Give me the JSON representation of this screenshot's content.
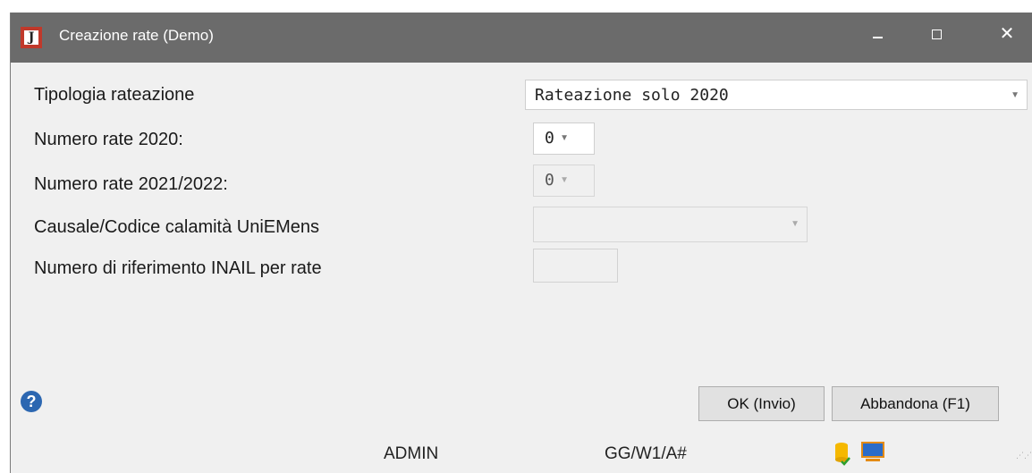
{
  "window": {
    "title": "Creazione rate  (Demo)",
    "app_icon_letter": "J",
    "controls": {
      "minimize": "–",
      "maximize": "□",
      "close": "✕"
    }
  },
  "form": {
    "rows": [
      {
        "label": "Tipologia rateazione",
        "value": "Rateazione solo 2020",
        "type": "dropdown",
        "enabled": true
      },
      {
        "label": "Numero rate 2020:",
        "value": "0",
        "type": "spinner",
        "enabled": true
      },
      {
        "label": "Numero rate 2021/2022:",
        "value": "0",
        "type": "spinner",
        "enabled": false
      },
      {
        "label": "Causale/Codice calamità UniEMens",
        "value": "",
        "type": "dropdown",
        "enabled": false
      },
      {
        "label": "Numero di riferimento INAIL per rate",
        "value": "",
        "type": "textbox",
        "enabled": false
      }
    ]
  },
  "buttons": {
    "ok": "OK (Invio)",
    "cancel": "Abbandona (F1)"
  },
  "help": {
    "icon": "help-icon",
    "glyph": "?"
  },
  "status_bar": {
    "user": "ADMIN",
    "code": "GG/W1/A#"
  },
  "colors": {
    "titlebar": "#6b6b6b",
    "window_bg": "#f0f0f0",
    "accent_icon": "#c0392b",
    "help_icon": "#2c67b1"
  }
}
